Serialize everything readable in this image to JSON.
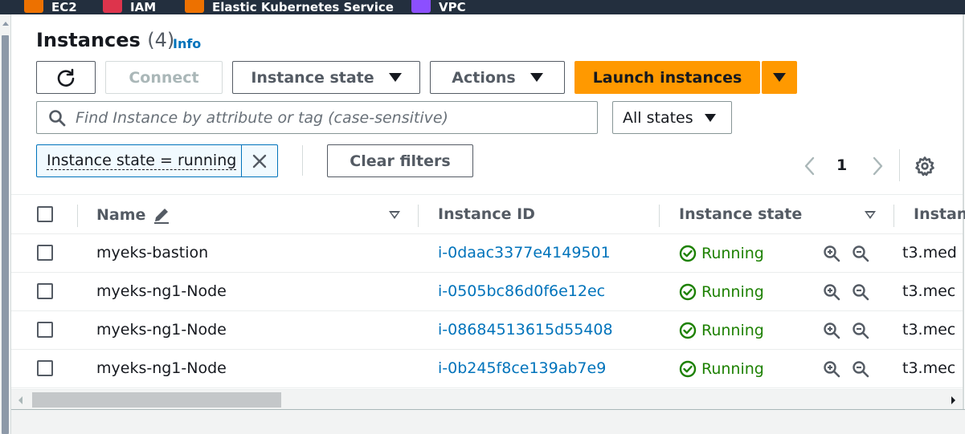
{
  "topbar": {
    "favorites": [
      {
        "label": "EC2",
        "icon": "ec2-icon",
        "color": "#ed7100"
      },
      {
        "label": "IAM",
        "icon": "iam-icon",
        "color": "#dd344c"
      },
      {
        "label": "Elastic Kubernetes Service",
        "icon": "eks-icon",
        "color": "#ed7100"
      },
      {
        "label": "VPC",
        "icon": "vpc-icon",
        "color": "#8c4fff"
      }
    ]
  },
  "header": {
    "title": "Instances",
    "count": "(4)",
    "info_link": "Info"
  },
  "toolbar": {
    "refresh_icon": "refresh-icon",
    "connect_label": "Connect",
    "instance_state_label": "Instance state",
    "actions_label": "Actions",
    "launch_label": "Launch instances"
  },
  "search": {
    "placeholder": "Find Instance by attribute or tag (case-sensitive)",
    "state_filter": "All states"
  },
  "filter": {
    "token": "Instance state = running",
    "clear_label": "Clear filters"
  },
  "pagination": {
    "current_page": "1"
  },
  "table": {
    "columns": [
      "Name",
      "Instance ID",
      "Instance state",
      "Instan"
    ],
    "rows": [
      {
        "name": "myeks-bastion",
        "id": "i-0daac3377e4149501",
        "state": "Running",
        "type": "t3.med"
      },
      {
        "name": "myeks-ng1-Node",
        "id": "i-0505bc86d0f6e12ec",
        "state": "Running",
        "type": "t3.mec"
      },
      {
        "name": "myeks-ng1-Node",
        "id": "i-08684513615d55408",
        "state": "Running",
        "type": "t3.mec"
      },
      {
        "name": "myeks-ng1-Node",
        "id": "i-0b245f8ce139ab7e9",
        "state": "Running",
        "type": "t3.mec"
      }
    ]
  },
  "colors": {
    "accent": "#0073bb",
    "primary_button": "#ff9900",
    "running": "#1d8102",
    "topbar": "#232f3e"
  }
}
